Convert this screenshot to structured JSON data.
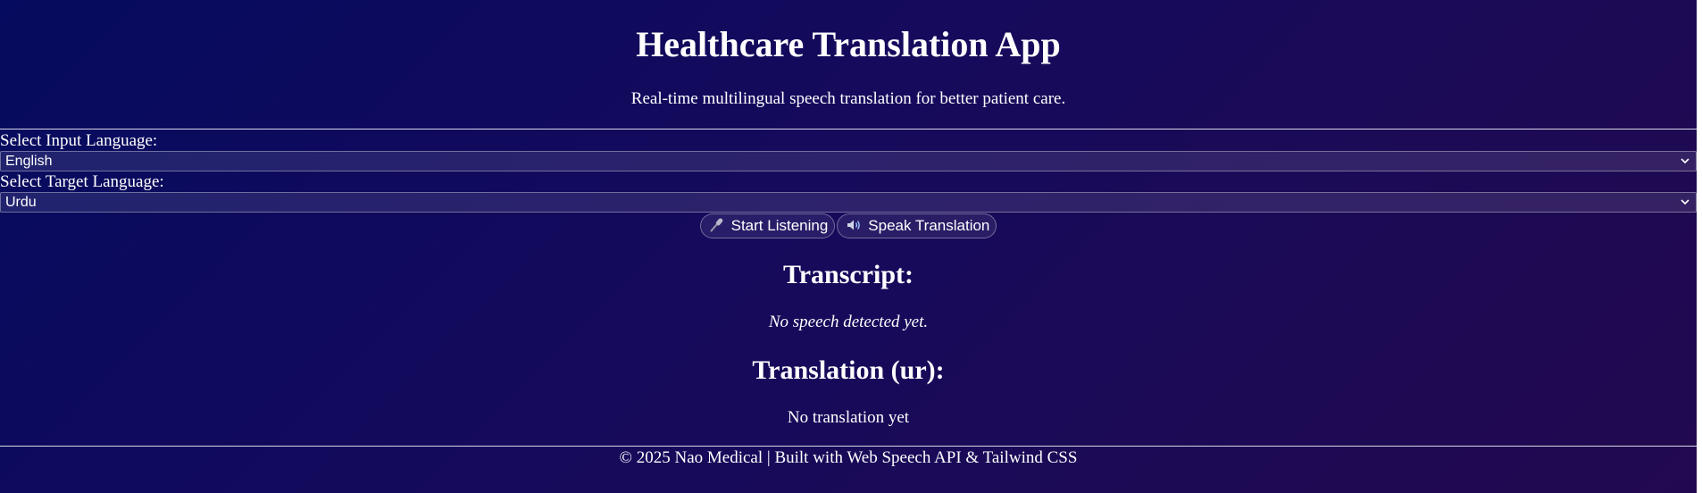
{
  "header": {
    "title": "Healthcare Translation App",
    "subtitle": "Real-time multilingual speech translation for better patient care."
  },
  "input_language": {
    "label": "Select Input Language:",
    "selected": "English"
  },
  "target_language": {
    "label": "Select Target Language:",
    "selected": "Urdu"
  },
  "buttons": {
    "start_listening": {
      "label": "Start Listening",
      "icon": "microphone-icon"
    },
    "speak_translation": {
      "label": "Speak Translation",
      "icon": "speaker-icon"
    }
  },
  "transcript": {
    "heading": "Transcript:",
    "text": "No speech detected yet."
  },
  "translation": {
    "heading": "Translation (ur):",
    "text": "No translation yet"
  },
  "footer": {
    "text": "© 2025 Nao Medical | Built with Web Speech API & Tailwind CSS"
  },
  "colors": {
    "background_start": "#050b5e",
    "background_end": "#22094f",
    "text": "#ffffff"
  }
}
